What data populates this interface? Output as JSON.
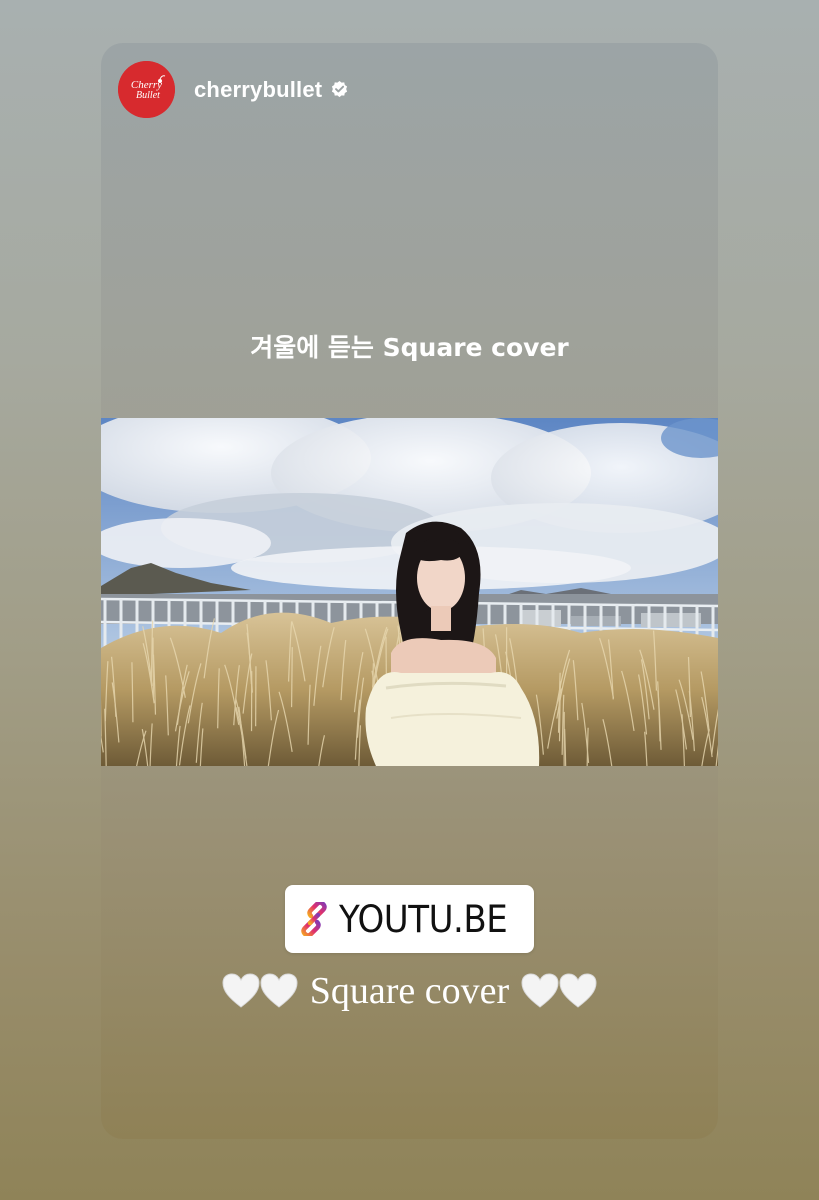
{
  "story": {
    "username": "cherrybullet",
    "verified": true,
    "avatar_logo_text": "Cherry Bullet",
    "caption": "겨울에 듣는 Square cover",
    "link_sticker": {
      "text": "YOUTU.BE",
      "icon": "link-icon"
    },
    "bottom_text": "Square cover",
    "heart_icon": "white-heart-icon",
    "colors": {
      "avatar_bg": "#d72a2e",
      "link_icon_gradient": [
        "#f5a623",
        "#e1306c",
        "#833ab4"
      ]
    }
  }
}
